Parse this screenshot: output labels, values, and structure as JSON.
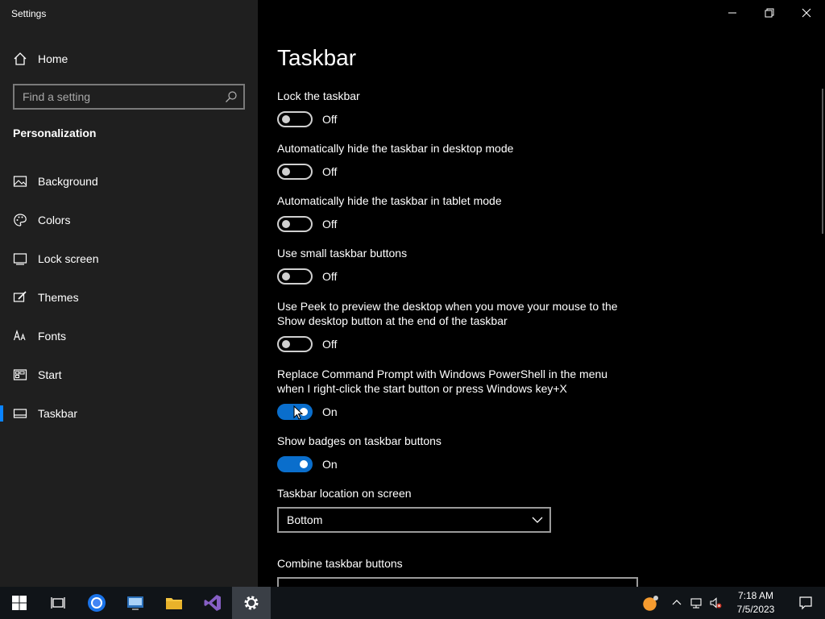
{
  "window": {
    "app_title": "Settings",
    "controls": [
      "minimize",
      "restore",
      "close"
    ]
  },
  "sidebar": {
    "home_label": "Home",
    "search_placeholder": "Find a setting",
    "section_title": "Personalization",
    "items": [
      {
        "label": "Background",
        "icon": "picture-icon"
      },
      {
        "label": "Colors",
        "icon": "palette-icon"
      },
      {
        "label": "Lock screen",
        "icon": "lock-screen-icon"
      },
      {
        "label": "Themes",
        "icon": "brush-icon"
      },
      {
        "label": "Fonts",
        "icon": "font-icon"
      },
      {
        "label": "Start",
        "icon": "start-icon"
      },
      {
        "label": "Taskbar",
        "icon": "taskbar-icon",
        "active": true
      }
    ]
  },
  "main": {
    "title": "Taskbar",
    "settings": [
      {
        "label": "Lock the taskbar",
        "state": "Off",
        "on": false
      },
      {
        "label": "Automatically hide the taskbar in desktop mode",
        "state": "Off",
        "on": false
      },
      {
        "label": "Automatically hide the taskbar in tablet mode",
        "state": "Off",
        "on": false
      },
      {
        "label": "Use small taskbar buttons",
        "state": "Off",
        "on": false
      },
      {
        "label": "Use Peek to preview the desktop when you move your mouse to the Show desktop button at the end of the taskbar",
        "state": "Off",
        "on": false
      },
      {
        "label": "Replace Command Prompt with Windows PowerShell in the menu when I right-click the start button or press Windows key+X",
        "state": "On",
        "on": true
      },
      {
        "label": "Show badges on taskbar buttons",
        "state": "On",
        "on": true
      }
    ],
    "location_label": "Taskbar location on screen",
    "location_value": "Bottom",
    "combine_label": "Combine taskbar buttons"
  },
  "taskbar": {
    "apps": [
      "windows-start-icon",
      "task-view-icon",
      "chrome-icon",
      "network-app-icon",
      "file-explorer-icon",
      "visual-studio-icon",
      "settings-gear-icon"
    ],
    "active_app": "settings-gear-icon",
    "tray": [
      "weather-icon",
      "chevron-up-icon",
      "network-icon",
      "volume-muted-icon"
    ],
    "time": "7:18 AM",
    "date": "7/5/2023"
  },
  "colors": {
    "accent": "#0a6ecc",
    "sidebar_bg": "#1f1f1f",
    "main_bg": "#000000",
    "taskbar_bg": "#101418"
  }
}
